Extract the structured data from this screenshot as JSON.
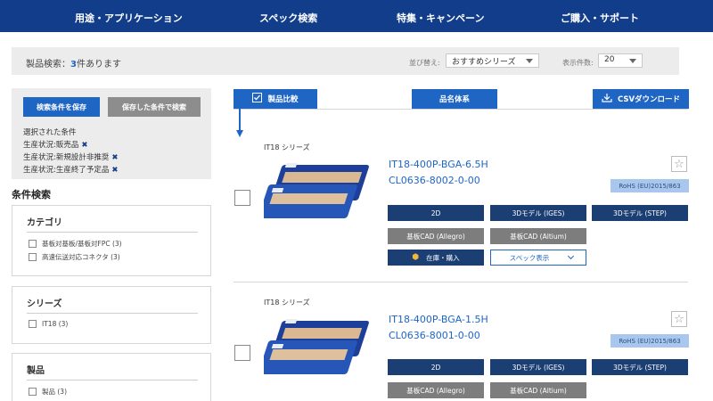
{
  "nav": {
    "items": [
      "用途・アプリケーション",
      "スペック検索",
      "特集・キャンペーン",
      "ご購入・サポート"
    ]
  },
  "result": {
    "prefix": "製品検索：",
    "count": "3",
    "suffix": "件あります",
    "sort_label": "並び替え:",
    "sort_value": "おすすめシリーズ",
    "perpage_label": "表示件数:",
    "perpage_value": "20"
  },
  "conditions": {
    "save_button": "検索条件を保存",
    "search_saved_button": "保存した条件で検索",
    "selected_heading": "選択された条件",
    "selected": [
      "生産状況:販売品",
      "生産状況:新規設計非推奨",
      "生産状況:生産終了予定品"
    ],
    "remove_icon": "✖"
  },
  "filters": {
    "title": "条件検索",
    "facets": [
      {
        "title": "カテゴリ",
        "options": [
          "基板対基板/基板対FPC (3)",
          "高速伝送対応コネクタ (3)"
        ]
      },
      {
        "title": "シリーズ",
        "options": [
          "IT18 (3)"
        ]
      },
      {
        "title": "製品",
        "options": [
          "製品 (3)"
        ]
      }
    ]
  },
  "toolbar": {
    "compare": "製品比較",
    "naming": "品名体系",
    "csv": "CSVダウンロード"
  },
  "products": [
    {
      "series": "IT18 シリーズ",
      "name": "IT18-400P-BGA-6.5H",
      "code": "CL0636-8002-0-00",
      "rohs": "RoHS (EU)2015/863",
      "btn_2d": "2D",
      "btn_iges": "3Dモデル (IGES)",
      "btn_step": "3Dモデル (STEP)",
      "btn_allegro": "基板CAD (Allegro)",
      "btn_altium": "基板CAD (Altium)",
      "btn_stock": "在庫・購入",
      "btn_spec": "スペック表示"
    },
    {
      "series": "IT18 シリーズ",
      "name": "IT18-400P-BGA-1.5H",
      "code": "CL0636-8001-0-00",
      "rohs": "RoHS (EU)2015/863",
      "btn_2d": "2D",
      "btn_iges": "3Dモデル (IGES)",
      "btn_step": "3Dモデル (STEP)",
      "btn_allegro": "基板CAD (Allegro)",
      "btn_altium": "基板CAD (Altium)"
    }
  ],
  "colors": {
    "nav_bg": "#123d8a",
    "primary": "#1f66c4",
    "navy_button": "#1b3e73",
    "gray_button": "#7d7d7d",
    "rohs_badge": "#a9c6ec",
    "stock_icon": "#f2b63b"
  },
  "icons": {
    "star": "☆",
    "cube": "⬢"
  }
}
